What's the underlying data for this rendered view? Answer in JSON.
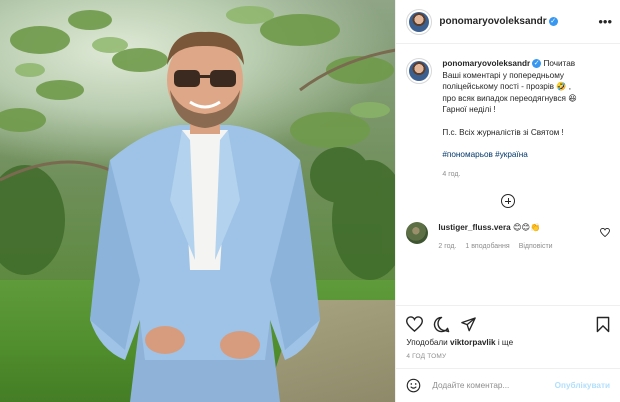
{
  "post": {
    "username": "ponomaryovoleksandr",
    "verified_mark": "✓",
    "more_icon": "more-horizontal-icon",
    "caption_lines": [
      "Почитав",
      "Ваші коментарі у попередньому",
      "поліцейському пості - прозрів 🤣 ,",
      "про всяк випадок переодягнувся 😆",
      "Гарної неділі !",
      "П.с. Всіх журналістів зі Святом !"
    ],
    "tags": "#пономарьов #україна",
    "caption_time": "4 год."
  },
  "comments": [
    {
      "username": "lustiger_fluss.vera",
      "text": "😊😊👏",
      "time": "2 год.",
      "likes": "1 вподобання",
      "reply": "Відповісти"
    }
  ],
  "actions": {
    "icons": [
      "heart-icon",
      "comment-icon",
      "share-icon",
      "bookmark-icon"
    ],
    "likes_prefix": "Уподобали",
    "likes_user": "viktorpavlik",
    "likes_suffix": "і ще",
    "post_time": "4 ГОД ТОМУ"
  },
  "add_comment": {
    "placeholder": "Додайте коментар...",
    "post_label": "Опублікувати"
  },
  "colors": {
    "accent": "#3897f0",
    "link": "#00376b",
    "muted": "#8e8e8e",
    "post_button": "#b2dffc"
  }
}
